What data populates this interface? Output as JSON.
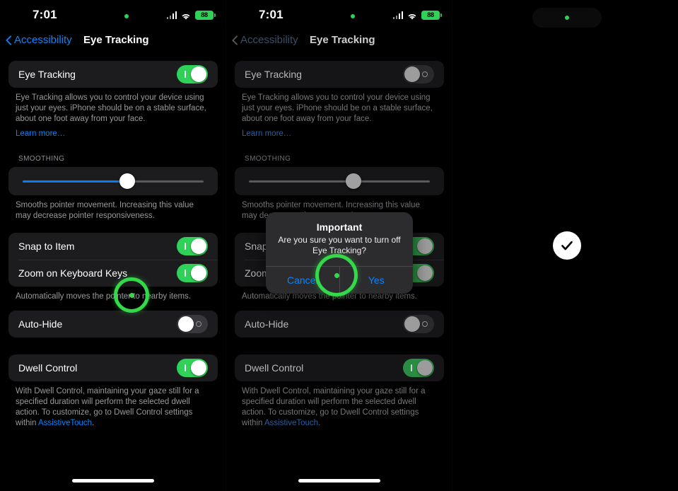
{
  "device": {
    "status_bar": {
      "time": "7:01",
      "privacy_dot": "green-recording-dot",
      "cellular_icon": "cellular-signal-icon",
      "wifi_icon": "wifi-icon",
      "battery_percent": "88",
      "battery_charging": true
    },
    "home_indicator": "home-indicator"
  },
  "nav": {
    "back_label": "Accessibility",
    "title": "Eye Tracking",
    "back_icon": "chevron-left-icon"
  },
  "settings": {
    "eye_tracking": {
      "label": "Eye Tracking",
      "enabled_left": true,
      "enabled_mid": false,
      "description": "Eye Tracking allows you to control your device using just your eyes. iPhone should be on a stable surface, about one foot away from your face.",
      "learn_more": "Learn more…"
    },
    "smoothing": {
      "header": "SMOOTHING",
      "value_percent": 58,
      "description": "Smooths pointer movement. Increasing this value may decrease pointer responsiveness."
    },
    "snap_to_item": {
      "label": "Snap to Item",
      "enabled": true
    },
    "zoom_on_keyboard_keys": {
      "label": "Zoom on Keyboard Keys",
      "enabled": true
    },
    "snap_footnote": "Automatically moves the pointer to nearby items.",
    "auto_hide": {
      "label": "Auto-Hide",
      "enabled": false
    },
    "dwell_control": {
      "label": "Dwell Control",
      "enabled": true,
      "description_before": "With Dwell Control, maintaining your gaze still for a specified duration will perform the selected dwell action. To customize, go to Dwell Control settings within ",
      "description_link": "AssistiveTouch",
      "description_after": "."
    }
  },
  "alert": {
    "title": "Important",
    "message": "Are you sure you want to turn off Eye Tracking?",
    "cancel_label": "Cancel",
    "confirm_label": "Yes"
  },
  "overlay": {
    "gaze_cursor_icon": "gaze-cursor-ring",
    "check_icon": "checkmark-icon",
    "dynamic_island": "dynamic-island"
  },
  "colors": {
    "accent_blue": "#0a84ff",
    "toggle_green": "#30d158",
    "gaze_green": "#34d94a",
    "card_bg": "#1c1c1e"
  }
}
